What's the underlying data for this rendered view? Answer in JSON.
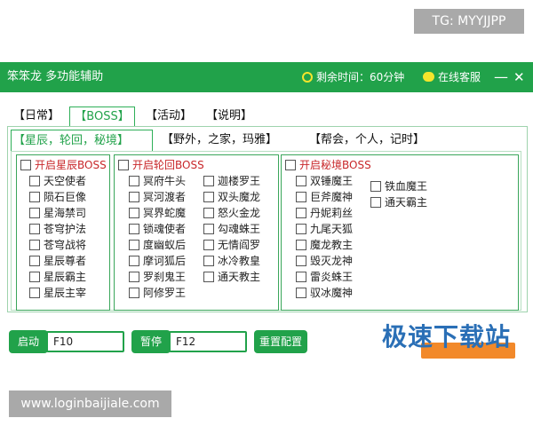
{
  "watermarks": {
    "top_right": "TG: MYYJJPP",
    "bottom_left": "www.loginbaijiale.com",
    "logo": "极速下载站"
  },
  "titlebar": {
    "title": "笨笨龙 多功能辅助",
    "time_left": "剩余时间：60分钟",
    "service": "在线客服",
    "minimize": "—",
    "close": "✕"
  },
  "top_tabs": [
    "【日常】",
    "【BOSS】",
    "【活动】",
    "【说明】"
  ],
  "sub_tabs": [
    "【星辰，轮回，秘境】",
    "【野外，之家，玛雅】",
    "【帮会，个人，记时】"
  ],
  "groups": {
    "xingchen": {
      "header": "开启星辰BOSS",
      "items": [
        "天空使者",
        "陨石巨像",
        "星海禁司",
        "苍穹护法",
        "苍穹战将",
        "星辰尊者",
        "星辰霸主",
        "星辰主宰"
      ]
    },
    "lunhui": {
      "header": "开启轮回BOSS",
      "col1": [
        "冥府牛头",
        "冥河渡者",
        "冥界蛇魔",
        "锁魂使者",
        "度幽蚁后",
        "摩诃狐后",
        "罗刹鬼王",
        "阿修罗王"
      ],
      "col2": [
        "迦楼罗王",
        "双头魔龙",
        "怒火金龙",
        "勾魂蛛王",
        "无情阎罗",
        "冰冷教皇",
        "通天教主"
      ]
    },
    "mijing": {
      "header": "开启秘境BOSS",
      "col1": [
        "双锤魔王",
        "巨斧魔神",
        "丹妮莉丝",
        "九尾天狐",
        "魔龙教主",
        "毁灭龙神",
        "雷炎蛛王",
        "驭冰魔神"
      ],
      "col2": [
        "铁血魔王",
        "通天霸主"
      ]
    }
  },
  "controls": {
    "start_label": "启动",
    "start_key": "F10",
    "pause_label": "暂停",
    "pause_key": "F12",
    "reset_label": "重置配置"
  },
  "colors": {
    "accent": "#21a24a",
    "header_red": "#c8272a"
  }
}
